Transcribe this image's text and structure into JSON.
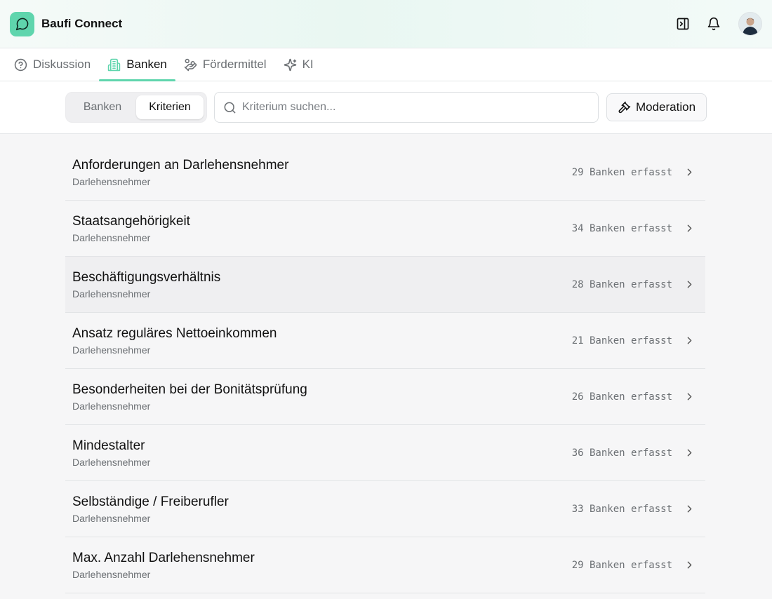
{
  "app": {
    "title": "Baufi Connect"
  },
  "tabs": [
    {
      "label": "Diskussion",
      "icon": "help-circle-icon",
      "active": false
    },
    {
      "label": "Banken",
      "icon": "building-icon",
      "active": true
    },
    {
      "label": "Fördermittel",
      "icon": "coins-icon",
      "active": false
    },
    {
      "label": "KI",
      "icon": "sparkles-icon",
      "active": false
    }
  ],
  "toolbar": {
    "segment": [
      "Banken",
      "Kriterien"
    ],
    "active_segment": "Kriterien",
    "search_placeholder": "Kriterium suchen...",
    "moderation_label": "Moderation"
  },
  "criteria": [
    {
      "title": "Anforderungen an Darlehensnehmer",
      "category": "Darlehensnehmer",
      "count": "29 Banken erfasst"
    },
    {
      "title": "Staatsangehörigkeit",
      "category": "Darlehensnehmer",
      "count": "34 Banken erfasst"
    },
    {
      "title": "Beschäftigungsverhältnis",
      "category": "Darlehensnehmer",
      "count": "28 Banken erfasst"
    },
    {
      "title": "Ansatz reguläres Nettoeinkommen",
      "category": "Darlehensnehmer",
      "count": "21 Banken erfasst"
    },
    {
      "title": "Besonderheiten bei der Bonitätsprüfung",
      "category": "Darlehensnehmer",
      "count": "26 Banken erfasst"
    },
    {
      "title": "Mindestalter",
      "category": "Darlehensnehmer",
      "count": "36 Banken erfasst"
    },
    {
      "title": "Selbständige / Freiberufler",
      "category": "Darlehensnehmer",
      "count": "33 Banken erfasst"
    },
    {
      "title": "Max. Anzahl Darlehensnehmer",
      "category": "Darlehensnehmer",
      "count": "29 Banken erfasst"
    }
  ],
  "colors": {
    "accent": "#5fd5ad",
    "muted": "#6b6f73",
    "background": "#f6f6f7"
  }
}
